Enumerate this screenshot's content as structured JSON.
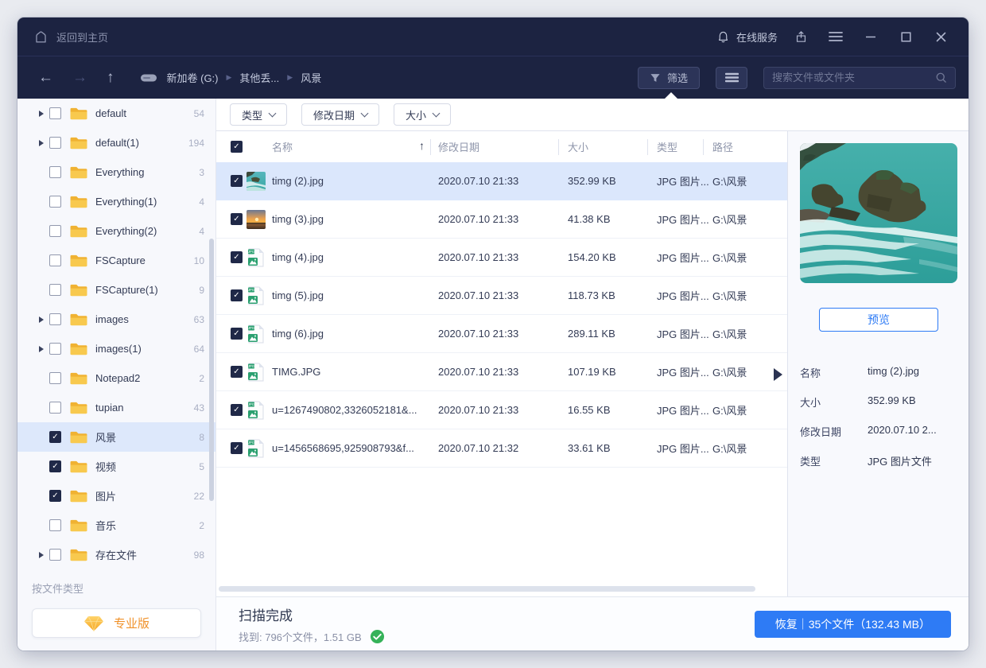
{
  "titlebar": {
    "home_label": "返回到主页",
    "online_service_label": "在线服务"
  },
  "navbar": {
    "breadcrumb": [
      {
        "label": "新加卷 (G:)"
      },
      {
        "label": "其他丢..."
      },
      {
        "label": "风景"
      }
    ],
    "filter_label": "筛选",
    "search_placeholder": "搜索文件或文件夹"
  },
  "filters": {
    "type_label": "类型",
    "date_label": "修改日期",
    "size_label": "大小"
  },
  "sidebar": {
    "items": [
      {
        "label": "default",
        "count": "54",
        "expandable": true,
        "checked": false,
        "selected": false
      },
      {
        "label": "default(1)",
        "count": "194",
        "expandable": true,
        "checked": false,
        "selected": false
      },
      {
        "label": "Everything",
        "count": "3",
        "expandable": false,
        "checked": false,
        "selected": false
      },
      {
        "label": "Everything(1)",
        "count": "4",
        "expandable": false,
        "checked": false,
        "selected": false
      },
      {
        "label": "Everything(2)",
        "count": "4",
        "expandable": false,
        "checked": false,
        "selected": false
      },
      {
        "label": "FSCapture",
        "count": "10",
        "expandable": false,
        "checked": false,
        "selected": false
      },
      {
        "label": "FSCapture(1)",
        "count": "9",
        "expandable": false,
        "checked": false,
        "selected": false
      },
      {
        "label": "images",
        "count": "63",
        "expandable": true,
        "checked": false,
        "selected": false
      },
      {
        "label": "images(1)",
        "count": "64",
        "expandable": true,
        "checked": false,
        "selected": false
      },
      {
        "label": "Notepad2",
        "count": "2",
        "expandable": false,
        "checked": false,
        "selected": false
      },
      {
        "label": "tupian",
        "count": "43",
        "expandable": false,
        "checked": false,
        "selected": false
      },
      {
        "label": "风景",
        "count": "8",
        "expandable": false,
        "checked": true,
        "selected": true
      },
      {
        "label": "视频",
        "count": "5",
        "expandable": false,
        "checked": true,
        "selected": false
      },
      {
        "label": "图片",
        "count": "22",
        "expandable": false,
        "checked": true,
        "selected": false
      },
      {
        "label": "音乐",
        "count": "2",
        "expandable": false,
        "checked": false,
        "selected": false
      },
      {
        "label": "存在文件",
        "count": "98",
        "expandable": true,
        "checked": false,
        "selected": false
      }
    ],
    "by_type_label": "按文件类型",
    "pro_label": "专业版"
  },
  "table": {
    "headers": {
      "name": "名称",
      "date": "修改日期",
      "size": "大小",
      "type": "类型",
      "path": "路径"
    },
    "rows": [
      {
        "name": "timg (2).jpg",
        "date": "2020.07.10 21:33",
        "size": "352.99 KB",
        "type": "JPG 图片...",
        "path": "G:\\风景"
      },
      {
        "name": "timg (3).jpg",
        "date": "2020.07.10 21:33",
        "size": "41.38 KB",
        "type": "JPG 图片...",
        "path": "G:\\风景"
      },
      {
        "name": "timg (4).jpg",
        "date": "2020.07.10 21:33",
        "size": "154.20 KB",
        "type": "JPG 图片...",
        "path": "G:\\风景"
      },
      {
        "name": "timg (5).jpg",
        "date": "2020.07.10 21:33",
        "size": "118.73 KB",
        "type": "JPG 图片...",
        "path": "G:\\风景"
      },
      {
        "name": "timg (6).jpg",
        "date": "2020.07.10 21:33",
        "size": "289.11 KB",
        "type": "JPG 图片...",
        "path": "G:\\风景"
      },
      {
        "name": "TIMG.JPG",
        "date": "2020.07.10 21:33",
        "size": "107.19 KB",
        "type": "JPG 图片...",
        "path": "G:\\风景"
      },
      {
        "name": "u=1267490802,3326052181&...",
        "date": "2020.07.10 21:33",
        "size": "16.55 KB",
        "type": "JPG 图片...",
        "path": "G:\\风景"
      },
      {
        "name": "u=1456568695,925908793&f...",
        "date": "2020.07.10 21:32",
        "size": "33.61 KB",
        "type": "JPG 图片...",
        "path": "G:\\风景"
      }
    ]
  },
  "preview": {
    "button_label": "预览",
    "details": [
      {
        "label": "名称",
        "value": "timg (2).jpg"
      },
      {
        "label": "大小",
        "value": "352.99 KB"
      },
      {
        "label": "修改日期",
        "value": "2020.07.10 2..."
      },
      {
        "label": "类型",
        "value": "JPG 图片文件"
      }
    ]
  },
  "statusbar": {
    "title": "扫描完成",
    "found_label": "找到: 796个文件，1.51 GB",
    "recover_label": "恢复｜35个文件（132.43 MB）"
  },
  "colors": {
    "accent": "#2e7bf5",
    "titlebar": "#1c2341",
    "success_green": "#35b259",
    "pro_orange": "#f0922b",
    "folder_yellow": "#f6c244",
    "selected_row": "#dbe7fc"
  }
}
